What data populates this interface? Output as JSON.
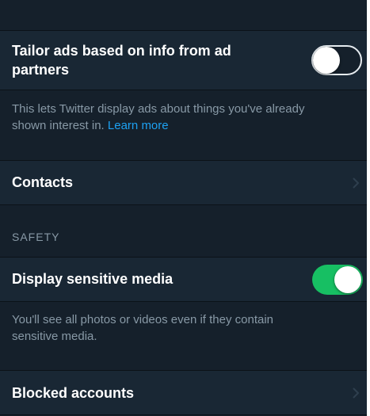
{
  "privacy": {
    "tailor_ads": {
      "label_line1": "Tailor ads based on info from ad",
      "label_line2": "partners",
      "enabled": false,
      "description_line1": "This lets Twitter display ads about things you've already",
      "description_line2": "shown interest in.",
      "learn_more": "Learn more"
    },
    "contacts": {
      "label": "Contacts",
      "chevron_icon": "chevron-right-icon"
    }
  },
  "safety": {
    "header": "SAFETY",
    "display_sensitive_media": {
      "label": "Display sensitive media",
      "enabled": true,
      "description_line1": "You'll see all photos or videos even if they contain",
      "description_line2": "sensitive media."
    },
    "blocked_accounts": {
      "label": "Blocked accounts",
      "chevron_icon": "chevron-right-icon"
    }
  },
  "colors": {
    "background": "#15202b",
    "row_background": "#192734",
    "accent_link": "#1da1f2",
    "toggle_on": "#17bf63",
    "secondary_text": "#8899a6"
  }
}
